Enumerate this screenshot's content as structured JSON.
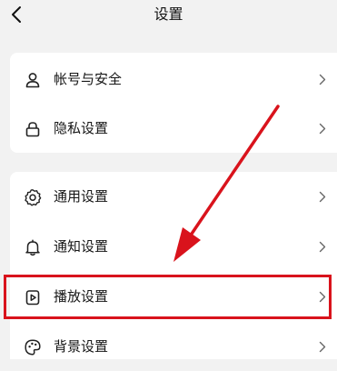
{
  "header": {
    "title": "设置",
    "back_icon": "chevron-left-icon"
  },
  "groups": [
    {
      "items": [
        {
          "label": "帐号与安全",
          "icon": "user-icon"
        },
        {
          "label": "隐私设置",
          "icon": "lock-icon"
        }
      ]
    },
    {
      "items": [
        {
          "label": "通用设置",
          "icon": "gear-icon"
        },
        {
          "label": "通知设置",
          "icon": "bell-icon"
        },
        {
          "label": "播放设置",
          "icon": "play-icon",
          "highlighted": true
        },
        {
          "label": "背景设置",
          "icon": "palette-icon"
        }
      ]
    }
  ],
  "annotation": {
    "color": "#d9131c",
    "type": "arrow-with-highlight-box",
    "target": "播放设置"
  }
}
